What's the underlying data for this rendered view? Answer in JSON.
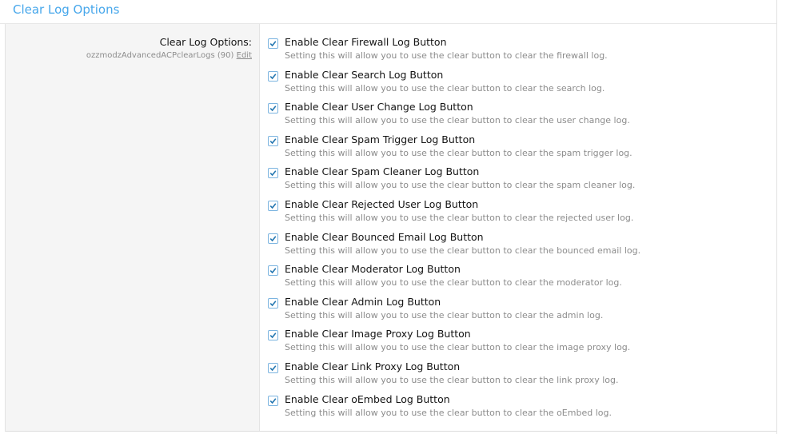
{
  "panel": {
    "title": "Clear Log Options"
  },
  "option": {
    "label": "Clear Log Options:",
    "meta": "ozzmodzAdvancedACPclearLogs (90)",
    "edit_label": "Edit"
  },
  "colors": {
    "title": "#47a7eb",
    "checkbox_border": "#7bb4e0",
    "checkmark": "#2577b1"
  },
  "items": [
    {
      "label": "Enable Clear Firewall Log Button",
      "hint": "Setting this will allow you to use the clear button to clear the firewall log.",
      "checked": true
    },
    {
      "label": "Enable Clear Search Log Button",
      "hint": "Setting this will allow you to use the clear button to clear the search log.",
      "checked": true
    },
    {
      "label": "Enable Clear User Change Log Button",
      "hint": "Setting this will allow you to use the clear button to clear the user change log.",
      "checked": true
    },
    {
      "label": "Enable Clear Spam Trigger Log Button",
      "hint": "Setting this will allow you to use the clear button to clear the spam trigger log.",
      "checked": true
    },
    {
      "label": "Enable Clear Spam Cleaner Log Button",
      "hint": "Setting this will allow you to use the clear button to clear the spam cleaner log.",
      "checked": true
    },
    {
      "label": "Enable Clear Rejected User Log Button",
      "hint": "Setting this will allow you to use the clear button to clear the rejected user log.",
      "checked": true
    },
    {
      "label": "Enable Clear Bounced Email Log Button",
      "hint": "Setting this will allow you to use the clear button to clear the bounced email log.",
      "checked": true
    },
    {
      "label": "Enable Clear Moderator Log Button",
      "hint": "Setting this will allow you to use the clear button to clear the moderator log.",
      "checked": true
    },
    {
      "label": "Enable Clear Admin Log Button",
      "hint": "Setting this will allow you to use the clear button to clear the admin log.",
      "checked": true
    },
    {
      "label": "Enable Clear Image Proxy Log Button",
      "hint": "Setting this will allow you to use the clear button to clear the image proxy log.",
      "checked": true
    },
    {
      "label": "Enable Clear Link Proxy Log Button",
      "hint": "Setting this will allow you to use the clear button to clear the link proxy log.",
      "checked": true
    },
    {
      "label": "Enable Clear oEmbed Log Button",
      "hint": "Setting this will allow you to use the clear button to clear the oEmbed log.",
      "checked": true
    }
  ]
}
